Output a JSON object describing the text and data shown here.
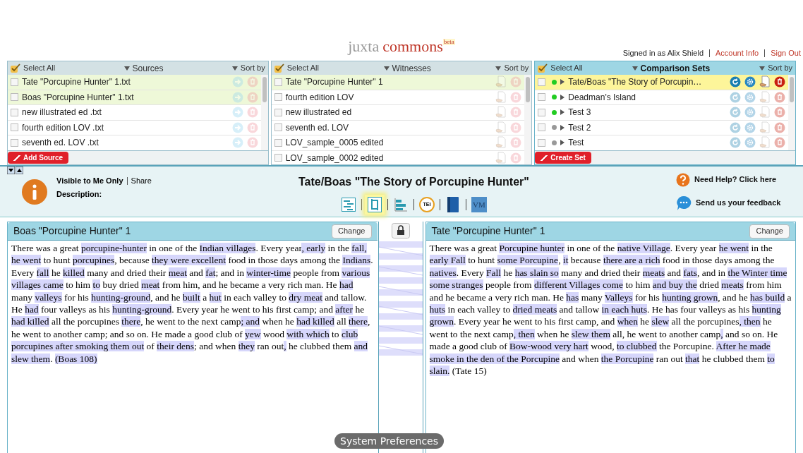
{
  "header": {
    "logo_word_1": "juxta",
    "logo_word_2": "commons",
    "logo_badge": "beta",
    "signed_in": "Signed in as Alix Shield",
    "links": [
      "Account Info",
      "Sign Out"
    ]
  },
  "panels": [
    {
      "kind": "sources",
      "select_all": "Select All",
      "title": "Sources",
      "sort": "Sort by",
      "button": "Add Source",
      "items": [
        {
          "label": "Tate \"Porcupine Hunter\" 1.txt",
          "selected": true
        },
        {
          "label": "Boas \"Porcupine Hunter\" 1.txt",
          "selected": true
        },
        {
          "label": "new illustrated ed .txt",
          "selected": false
        },
        {
          "label": "fourth edition LOV .txt",
          "selected": false
        },
        {
          "label": "seventh ed. LOV .txt",
          "selected": false
        }
      ]
    },
    {
      "kind": "witnesses",
      "select_all": "Select All",
      "title": "Witnesses",
      "sort": "Sort by",
      "items": [
        {
          "label": "Tate \"Porcupine Hunter\" 1",
          "selected": true
        },
        {
          "label": "fourth edition LOV",
          "selected": false
        },
        {
          "label": "new illustrated ed",
          "selected": false
        },
        {
          "label": "seventh ed. LOV",
          "selected": false
        },
        {
          "label": "LOV_sample_0005 edited",
          "selected": false
        },
        {
          "label": "LOV_sample_0002 edited",
          "selected": false
        }
      ]
    },
    {
      "kind": "sets",
      "select_all": "Select All",
      "title": "Comparison Sets",
      "sort": "Sort by",
      "button": "Create Set",
      "items": [
        {
          "label": "Tate/Boas \"The Story of Porcupin…",
          "selected": true,
          "color": "#22cc22"
        },
        {
          "label": "Deadman's Island",
          "selected": false,
          "color": "#22cc22"
        },
        {
          "label": "Test 3",
          "selected": false,
          "color": "#22cc22"
        },
        {
          "label": "Test 2",
          "selected": false,
          "color": "#999999"
        },
        {
          "label": "Test",
          "selected": false,
          "color": "#999999"
        }
      ]
    }
  ],
  "set_bar": {
    "visibility": "Visible to Me Only",
    "share": "Share",
    "description": "Description:",
    "title": "Tate/Boas \"The Story of Porcupine Hunter\"",
    "help": "Need Help? Click here",
    "feedback": "Send us your feedback",
    "views": [
      {
        "kind": "heatmap",
        "selected": false
      },
      {
        "kind": "side-by-side",
        "selected": true
      },
      {
        "kind": "histogram",
        "selected": false
      },
      {
        "kind": "tei",
        "label": "TEI",
        "selected": false
      },
      {
        "kind": "book",
        "selected": false
      },
      {
        "kind": "vm",
        "label": "VM",
        "selected": false
      }
    ]
  },
  "witness_panes": [
    {
      "title": "Boas \"Porcupine Hunter\" 1",
      "button": "Change",
      "segments": [
        {
          "text": "There was a great ",
          "diff": false
        },
        {
          "text": "porcupine-hunter",
          "diff": true
        },
        {
          "text": " in one of the ",
          "diff": false
        },
        {
          "text": "Indian villages",
          "diff": true
        },
        {
          "text": ". Every year",
          "diff": false
        },
        {
          "text": ", early",
          "diff": true
        },
        {
          "text": " in the ",
          "diff": false
        },
        {
          "text": "fall, he went",
          "diff": true
        },
        {
          "text": " to hunt ",
          "diff": false
        },
        {
          "text": "porcupines",
          "diff": true
        },
        {
          "text": ", because ",
          "diff": false
        },
        {
          "text": "they were excellent",
          "diff": true
        },
        {
          "text": " food in those days among the ",
          "diff": false
        },
        {
          "text": "Indians",
          "diff": true
        },
        {
          "text": ". Every ",
          "diff": false
        },
        {
          "text": "fall",
          "diff": true
        },
        {
          "text": " he ",
          "diff": false
        },
        {
          "text": "killed",
          "diff": true
        },
        {
          "text": " many and dried their ",
          "diff": false
        },
        {
          "text": "meat",
          "diff": true
        },
        {
          "text": " and ",
          "diff": false
        },
        {
          "text": "fat",
          "diff": true
        },
        {
          "text": "; and in ",
          "diff": false
        },
        {
          "text": "winter-time",
          "diff": true
        },
        {
          "text": " people from ",
          "diff": false
        },
        {
          "text": "various villages came",
          "diff": true
        },
        {
          "text": " to him ",
          "diff": false
        },
        {
          "text": "to",
          "diff": true
        },
        {
          "text": " buy dried ",
          "diff": false
        },
        {
          "text": "meat",
          "diff": true
        },
        {
          "text": " from him, and he became a very rich man. He ",
          "diff": false
        },
        {
          "text": "had",
          "diff": true
        },
        {
          "text": " many ",
          "diff": false
        },
        {
          "text": "valleys",
          "diff": true
        },
        {
          "text": " for his ",
          "diff": false
        },
        {
          "text": "hunting-ground",
          "diff": true
        },
        {
          "text": ", and he ",
          "diff": false
        },
        {
          "text": "built",
          "diff": true
        },
        {
          "text": " a ",
          "diff": false
        },
        {
          "text": "hut",
          "diff": true
        },
        {
          "text": " in each valley to ",
          "diff": false
        },
        {
          "text": "dry meat",
          "diff": true
        },
        {
          "text": " and tallow. He ",
          "diff": false
        },
        {
          "text": "had",
          "diff": true
        },
        {
          "text": " four valleys as his ",
          "diff": false
        },
        {
          "text": "hunting-ground",
          "diff": true
        },
        {
          "text": ". Every year he went to his first camp; and ",
          "diff": false
        },
        {
          "text": "after",
          "diff": true
        },
        {
          "text": " he ",
          "diff": false
        },
        {
          "text": "had killed",
          "diff": true
        },
        {
          "text": " all the porcupines ",
          "diff": false
        },
        {
          "text": "there",
          "diff": true
        },
        {
          "text": ", he went to the next camp",
          "diff": false
        },
        {
          "text": "; and",
          "diff": true
        },
        {
          "text": " when he ",
          "diff": false
        },
        {
          "text": "had killed",
          "diff": true
        },
        {
          "text": " all ",
          "diff": false
        },
        {
          "text": "there",
          "diff": true
        },
        {
          "text": ", he went to another camp; and so on. He made a good club of ",
          "diff": false
        },
        {
          "text": "yew",
          "diff": true
        },
        {
          "text": " wood ",
          "diff": false
        },
        {
          "text": "with which",
          "diff": true
        },
        {
          "text": " to ",
          "diff": false
        },
        {
          "text": "club porcupines after smoking them out",
          "diff": true
        },
        {
          "text": " of ",
          "diff": false
        },
        {
          "text": "their dens",
          "diff": true
        },
        {
          "text": "; and when ",
          "diff": false
        },
        {
          "text": "they",
          "diff": true
        },
        {
          "text": " ran out",
          "diff": false
        },
        {
          "text": ",",
          "diff": true
        },
        {
          "text": " he clubbed them ",
          "diff": false
        },
        {
          "text": "and slew them",
          "diff": true
        },
        {
          "text": ". ",
          "diff": false
        },
        {
          "text": "(Boas 108)",
          "diff": true
        }
      ]
    },
    {
      "title": "Tate \"Porcupine Hunter\" 1",
      "button": "Change",
      "segments": [
        {
          "text": "There was a great ",
          "diff": false
        },
        {
          "text": "Porcupine hunter",
          "diff": true
        },
        {
          "text": " in one of the ",
          "diff": false
        },
        {
          "text": "native Village",
          "diff": true
        },
        {
          "text": ". Every year ",
          "diff": false
        },
        {
          "text": "he went",
          "diff": true
        },
        {
          "text": " in the ",
          "diff": false
        },
        {
          "text": "early Fall",
          "diff": true
        },
        {
          "text": " to hunt ",
          "diff": false
        },
        {
          "text": "some Porcupine",
          "diff": true
        },
        {
          "text": ", ",
          "diff": false
        },
        {
          "text": "it",
          "diff": true
        },
        {
          "text": " because ",
          "diff": false
        },
        {
          "text": "there are a rich",
          "diff": true
        },
        {
          "text": " food in those days among the ",
          "diff": false
        },
        {
          "text": "natives",
          "diff": true
        },
        {
          "text": ". Every ",
          "diff": false
        },
        {
          "text": "Fall",
          "diff": true
        },
        {
          "text": " he ",
          "diff": false
        },
        {
          "text": "has slain so",
          "diff": true
        },
        {
          "text": " many and dried their ",
          "diff": false
        },
        {
          "text": "meats",
          "diff": true
        },
        {
          "text": " and ",
          "diff": false
        },
        {
          "text": "fats",
          "diff": true
        },
        {
          "text": ", and in ",
          "diff": false
        },
        {
          "text": "the Winter time some stranges",
          "diff": true
        },
        {
          "text": " people from ",
          "diff": false
        },
        {
          "text": "different Villages come",
          "diff": true
        },
        {
          "text": " to him ",
          "diff": false
        },
        {
          "text": "and buy the",
          "diff": true
        },
        {
          "text": " dried ",
          "diff": false
        },
        {
          "text": "meats",
          "diff": true
        },
        {
          "text": " from him and he became a very rich man. He ",
          "diff": false
        },
        {
          "text": "has",
          "diff": true
        },
        {
          "text": " many ",
          "diff": false
        },
        {
          "text": "Valleys",
          "diff": true
        },
        {
          "text": " for his ",
          "diff": false
        },
        {
          "text": "hunting grown",
          "diff": true
        },
        {
          "text": ", and he ",
          "diff": false
        },
        {
          "text": "has build",
          "diff": true
        },
        {
          "text": " a ",
          "diff": false
        },
        {
          "text": "huts",
          "diff": true
        },
        {
          "text": " in each valley to ",
          "diff": false
        },
        {
          "text": "dried meats",
          "diff": true
        },
        {
          "text": " and tallow ",
          "diff": false
        },
        {
          "text": "in each huts",
          "diff": true
        },
        {
          "text": ". He has four valleys as his ",
          "diff": false
        },
        {
          "text": "hunting grown",
          "diff": true
        },
        {
          "text": ". Every year he went to his first camp, and ",
          "diff": false
        },
        {
          "text": "when",
          "diff": true
        },
        {
          "text": " he ",
          "diff": false
        },
        {
          "text": "slew",
          "diff": true
        },
        {
          "text": " all the porcupines",
          "diff": false
        },
        {
          "text": ", then",
          "diff": true
        },
        {
          "text": " he went to the next camp",
          "diff": false
        },
        {
          "text": ", then",
          "diff": true
        },
        {
          "text": " when he ",
          "diff": false
        },
        {
          "text": "slew them",
          "diff": true
        },
        {
          "text": " all, he went to another camp",
          "diff": false
        },
        {
          "text": ",",
          "diff": true
        },
        {
          "text": " and so on. He made a good club of ",
          "diff": false
        },
        {
          "text": "Bow-wood very hart",
          "diff": true
        },
        {
          "text": " wood, ",
          "diff": false
        },
        {
          "text": "to clubbed",
          "diff": true
        },
        {
          "text": " the Porcupine. ",
          "diff": false
        },
        {
          "text": "After he made smoke in the den of the Porcupine",
          "diff": true
        },
        {
          "text": " and when ",
          "diff": false
        },
        {
          "text": "the Porcupine",
          "diff": true
        },
        {
          "text": " ran out ",
          "diff": false
        },
        {
          "text": "that",
          "diff": true
        },
        {
          "text": " he clubbed them ",
          "diff": false
        },
        {
          "text": "to slain.",
          "diff": true
        },
        {
          "text": " (Tate 15)",
          "diff": false
        }
      ]
    }
  ],
  "tooltip": "System Preferences"
}
